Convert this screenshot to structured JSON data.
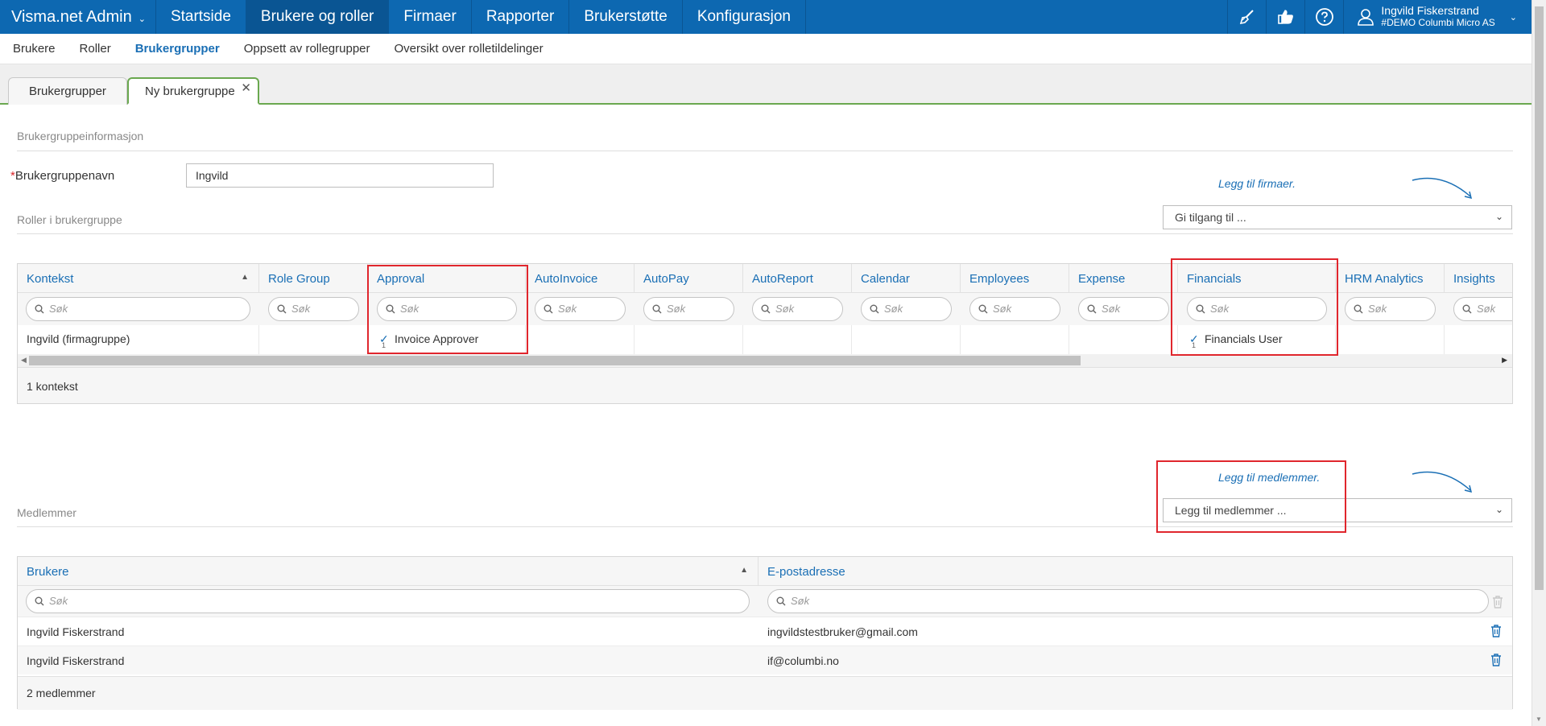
{
  "app": {
    "title": "Visma.net Admin"
  },
  "nav": {
    "items": [
      {
        "label": "Startside",
        "active": false
      },
      {
        "label": "Brukere og roller",
        "active": true
      },
      {
        "label": "Firmaer",
        "active": false
      },
      {
        "label": "Rapporter",
        "active": false
      },
      {
        "label": "Brukerstøtte",
        "active": false
      },
      {
        "label": "Konfigurasjon",
        "active": false
      }
    ]
  },
  "user": {
    "name": "Ingvild Fiskerstrand",
    "company": "#DEMO Columbi Micro AS"
  },
  "topicons": [
    "broom-icon",
    "thumbs-icon",
    "help-icon"
  ],
  "subnav": {
    "items": [
      {
        "label": "Brukere",
        "active": false
      },
      {
        "label": "Roller",
        "active": false
      },
      {
        "label": "Brukergrupper",
        "active": true
      },
      {
        "label": "Oppsett av rollegrupper",
        "active": false
      },
      {
        "label": "Oversikt over rolletildelinger",
        "active": false
      }
    ]
  },
  "tabs": {
    "first": "Brukergrupper",
    "second": "Ny brukergruppe"
  },
  "info": {
    "section_title": "Brukergruppeinformasjon",
    "name_label": "Brukergruppenavn",
    "name_required": "*",
    "name_value": "Ingvild"
  },
  "roles": {
    "section_title": "Roller i brukergruppe",
    "hint": "Legg til firmaer.",
    "dropdown": "Gi tilgang til ...",
    "search_placeholder": "Søk",
    "columns": [
      "Kontekst",
      "Role Group",
      "Approval",
      "AutoInvoice",
      "AutoPay",
      "AutoReport",
      "Calendar",
      "Employees",
      "Expense",
      "Financials",
      "HRM Analytics",
      "Insights"
    ],
    "row": {
      "context": "Ingvild (firmagruppe)",
      "approval": "Invoice Approver",
      "approval_count": "1",
      "financials": "Financials User",
      "financials_count": "1"
    },
    "footer": "1 kontekst"
  },
  "members": {
    "section_title": "Medlemmer",
    "hint": "Legg til medlemmer.",
    "dropdown": "Legg til medlemmer ...",
    "search_placeholder": "Søk",
    "columns": [
      "Brukere",
      "E-postadresse"
    ],
    "rows": [
      {
        "user": "Ingvild Fiskerstrand",
        "email": "ingvildstestbruker@gmail.com"
      },
      {
        "user": "Ingvild Fiskerstrand",
        "email": "if@columbi.no"
      }
    ],
    "footer": "2 medlemmer"
  },
  "colors": {
    "brand": "#0d68b1",
    "link": "#1a6fb5",
    "highlight": "#e0262d",
    "tab_accent": "#6aa84f"
  }
}
